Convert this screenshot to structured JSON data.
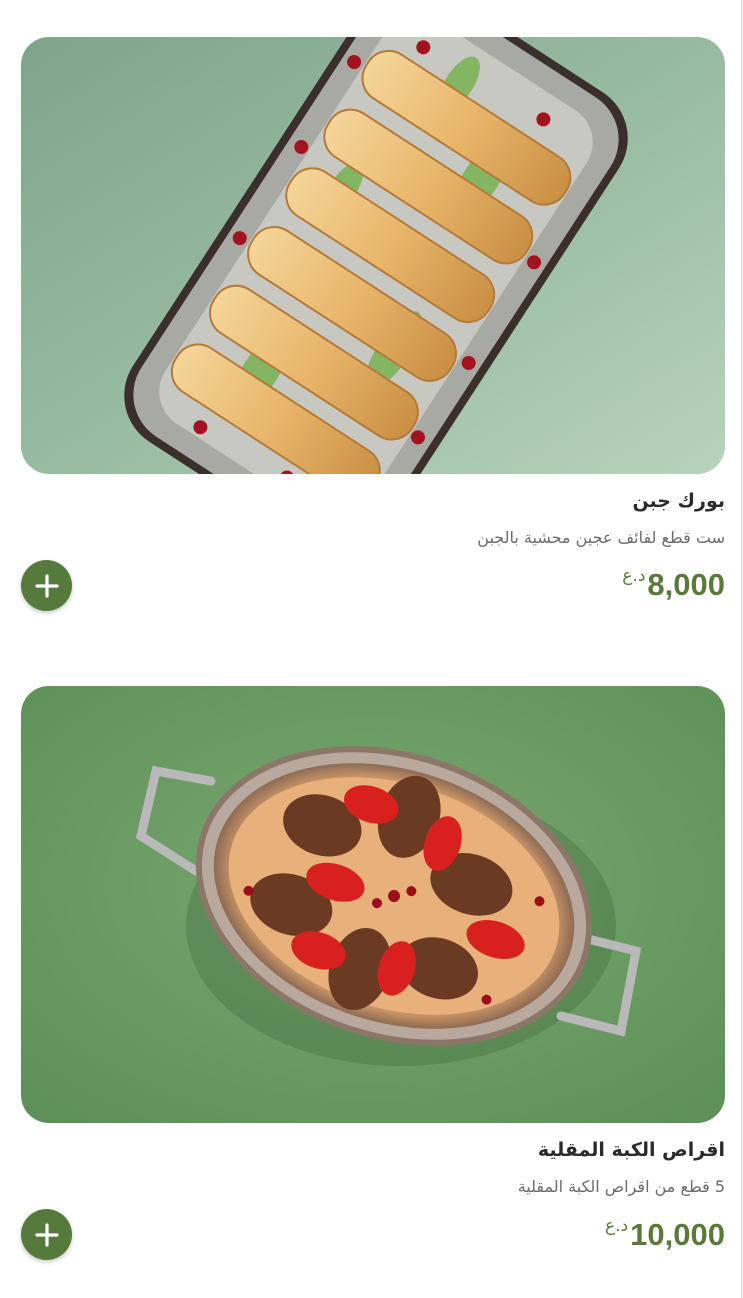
{
  "menu": {
    "items": [
      {
        "name": "بورك جبن",
        "description": "ست قطع لفائف عجين محشية بالجبن",
        "price": "8,000",
        "currency": "د.ع",
        "image_icon": "cheese-borek-photo-icon"
      },
      {
        "name": "اقراص الكبة المقلية",
        "description": "5 قطع من اقراص الكبة المقلية",
        "price": "10,000",
        "currency": "د.ع",
        "image_icon": "fried-kibbeh-photo-icon"
      }
    ],
    "add_button_icon": "plus-icon"
  },
  "colors": {
    "accent": "#557a3b",
    "price": "#5b7a3a",
    "title": "#2b2b2b",
    "description": "#6b6b6b"
  }
}
